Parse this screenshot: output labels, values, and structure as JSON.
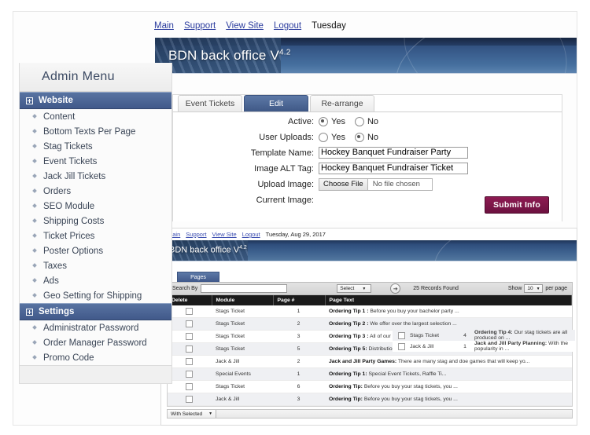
{
  "topnav": {
    "links": [
      "Main",
      "Support",
      "View Site",
      "Logout"
    ],
    "day": "Tuesday"
  },
  "banner": {
    "title": "BDN back office V",
    "version": "4.2"
  },
  "sidebar": {
    "heading": "Admin Menu",
    "groups": [
      {
        "label": "Website",
        "items": [
          "Content",
          "Bottom Texts Per Page",
          "Stag Tickets",
          "Event Tickets",
          "Jack Jill Tickets",
          "Orders",
          "SEO Module",
          "Shipping Costs",
          "Ticket Prices",
          "Poster Options",
          "Taxes",
          "Ads",
          "Geo Setting for Shipping"
        ]
      },
      {
        "label": "Settings",
        "items": [
          "Administrator Password",
          "Order Manager Password",
          "Promo Code"
        ]
      }
    ]
  },
  "panel": {
    "tabs": [
      {
        "label": "Event Tickets",
        "active": false
      },
      {
        "label": "Edit",
        "active": true
      },
      {
        "label": "Re-arrange",
        "active": false
      }
    ],
    "form": {
      "active_label": "Active:",
      "active_yes": "Yes",
      "active_no": "No",
      "active_selected": "Yes",
      "uploads_label": "User Uploads:",
      "uploads_yes": "Yes",
      "uploads_no": "No",
      "uploads_selected": "No",
      "template_name_label": "Template Name:",
      "template_name_value": "Hockey Banquet Fundraiser Party",
      "alt_tag_label": "Image ALT Tag:",
      "alt_tag_value": "Hockey Banquet Fundraiser Ticket",
      "upload_image_label": "Upload Image:",
      "choose_file": "Choose File",
      "file_status": "No file chosen",
      "current_image_label": "Current Image:",
      "submit_label": "Submit Info"
    }
  },
  "lower": {
    "topnav": {
      "links": [
        "Main",
        "Support",
        "View Site",
        "Logout"
      ],
      "date": "Tuesday, Aug 29, 2017"
    },
    "banner": {
      "title": "BDN back office V",
      "version": "4.2"
    },
    "tab_label": "Pages",
    "toolbar": {
      "search_label": "Search By",
      "search_value": "",
      "select_label": "Select",
      "go_icon": "arrow-right-icon",
      "records_found": "25 Records Found",
      "show_label": "Show",
      "per_page_value": "10",
      "per_page_label": "per page"
    },
    "table": {
      "columns": [
        "Delete",
        "Module",
        "Page #",
        "Page Text"
      ],
      "rows": [
        {
          "module": "Stags Ticket",
          "page": "1",
          "tip": "Ordering Tip 1 :",
          "text": " Before you buy your bachelor party ..."
        },
        {
          "module": "Stags Ticket",
          "page": "2",
          "tip": "Ordering Tip 2 :",
          "text": " We offer over the largest selection ..."
        },
        {
          "module": "Stags Ticket",
          "page": "3",
          "tip": "Ordering Tip 3 :",
          "text": " All of our"
        },
        {
          "module": "Stags Ticket",
          "page": "5",
          "tip": "Ordering Tip 5:",
          "text": " Distribution of your"
        },
        {
          "module": "Jack & Jill",
          "page": "2",
          "tip": "Jack and Jill Party Games:",
          "text": " There are many stag and doe games that will keep yo..."
        },
        {
          "module": "Special Events",
          "page": "1",
          "tip": "Ordering Tip 1:",
          "text": " Special Event Tickets, Raffle Ti..."
        },
        {
          "module": "Stags Ticket",
          "page": "6",
          "tip": "Ordering Tip:",
          "text": " Before you buy your stag tickets, you ..."
        },
        {
          "module": "Jack & Jill",
          "page": "3",
          "tip": "Ordering Tip:",
          "text": " Before you buy your stag tickets, you ..."
        }
      ],
      "overlay_rows": [
        {
          "module": "Stags Ticket",
          "page": "4",
          "tip": "Ordering Tip 4:",
          "text": " Our stag tickets are all produced on ..."
        },
        {
          "module": "Jack & Jill",
          "page": "1",
          "tip": "Jack and Jill Party Planning:",
          "text": " With the popularity in ..."
        }
      ]
    },
    "with_selected_label": "With Selected"
  },
  "colors": {
    "accent_blue": "#41598a",
    "banner_dark": "#1f3558",
    "submit_maroon": "#7b1546",
    "link_blue": "#2b3c9e"
  }
}
